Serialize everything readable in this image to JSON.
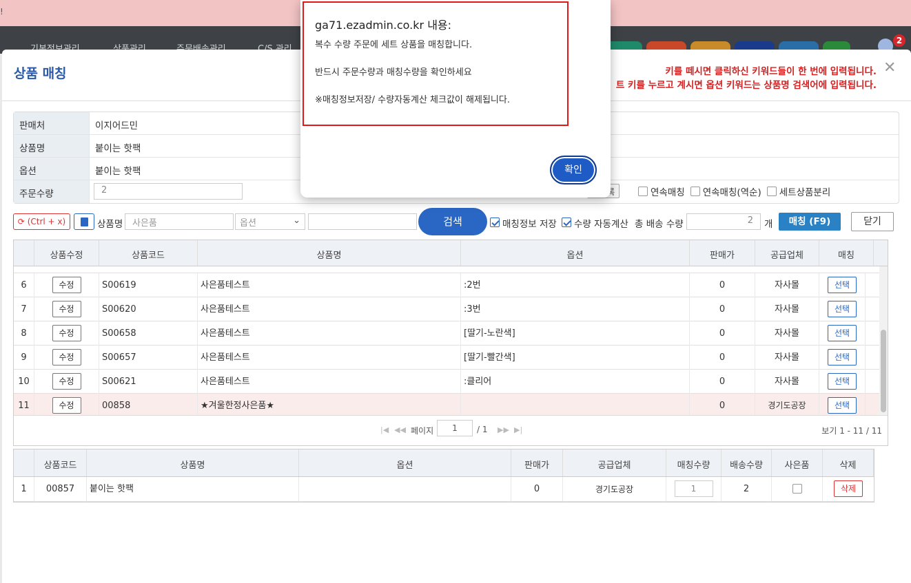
{
  "topbar": {
    "left_label": "!"
  },
  "nav": {
    "items": [
      "기본정보관리",
      "상품관리",
      "주문배송관리",
      "C/S 관리"
    ],
    "notification_count": "2"
  },
  "modal": {
    "title": "상품 매칭",
    "warnings": [
      "키를 떼시면 클릭하신 키워드들이 한 번에 입력됩니다.",
      "트 키를 누르고 계시면 옵션 키워드는 상품명 검색어에 입력됩니다."
    ],
    "info": {
      "rows": [
        {
          "label": "판매처",
          "value": "이지어드민"
        },
        {
          "label": "상품명",
          "value": "붙이는 핫팩"
        },
        {
          "label": "옵션",
          "value": "붙이는 핫팩"
        },
        {
          "label": "주문수량",
          "value": "2"
        }
      ],
      "register_btn": "품등록",
      "checkboxes": [
        {
          "label": "연속매칭"
        },
        {
          "label": "연속매칭(역순)"
        },
        {
          "label": "세트상품분리"
        }
      ]
    },
    "toolbar": {
      "refresh_label": "(Ctrl + x)",
      "product_name_label": "상품명",
      "product_name_placeholder": "사은품",
      "option_select": "옵션",
      "search_button": "검색",
      "save_match_label": "매칭정보 저장",
      "auto_qty_label": "수량 자동계산",
      "total_ship_qty_label": "총 배송 수량",
      "total_ship_qty_value": "2",
      "unit": "개",
      "match_button": "매칭 (F9)",
      "close_button": "닫기"
    },
    "grid": {
      "headers": [
        "상품수정",
        "상품코드",
        "상품명",
        "옵션",
        "판매가",
        "공급업체",
        "매칭"
      ],
      "rows": [
        {
          "no": "6",
          "edit": "수정",
          "code": "S00619",
          "name": "사은품테스트",
          "option": ":2번",
          "price": "0",
          "supplier": "자사몰",
          "select": "선택"
        },
        {
          "no": "7",
          "edit": "수정",
          "code": "S00620",
          "name": "사은품테스트",
          "option": ":3번",
          "price": "0",
          "supplier": "자사몰",
          "select": "선택"
        },
        {
          "no": "8",
          "edit": "수정",
          "code": "S00658",
          "name": "사은품테스트",
          "option": "[딸기-노란색]",
          "price": "0",
          "supplier": "자사몰",
          "select": "선택"
        },
        {
          "no": "9",
          "edit": "수정",
          "code": "S00657",
          "name": "사은품테스트",
          "option": "[딸기-빨간색]",
          "price": "0",
          "supplier": "자사몰",
          "select": "선택"
        },
        {
          "no": "10",
          "edit": "수정",
          "code": "S00621",
          "name": "사은품테스트",
          "option": ":클리어",
          "price": "0",
          "supplier": "자사몰",
          "select": "선택"
        },
        {
          "no": "11",
          "edit": "수정",
          "code": "00858",
          "name": "★겨울한정사은품★",
          "option": "",
          "price": "0",
          "supplier": "경기도공장",
          "select": "선택"
        }
      ],
      "pager": {
        "page_label": "페이지",
        "page_value": "1",
        "page_total": "/ 1",
        "view_text": "보기 1 - 11 / 11"
      }
    },
    "grid2": {
      "headers": [
        "상품코드",
        "상품명",
        "옵션",
        "판매가",
        "공급업체",
        "매칭수량",
        "배송수량",
        "사은품",
        "삭제"
      ],
      "rows": [
        {
          "no": "1",
          "code": "00857",
          "name": "붙이는 핫팩",
          "option": "",
          "price": "0",
          "supplier": "경기도공장",
          "match_qty": "1",
          "ship_qty": "2",
          "delete": "삭제"
        }
      ]
    }
  },
  "dialog": {
    "title": "ga71.ezadmin.co.kr 내용:",
    "lines": [
      "복수 수량 주문에 세트 상품을 매칭합니다.",
      "반드시 주문수량과 매칭수량을 확인하세요",
      "※매칭정보저장/ 수량자동계산 체크값이 해제됩니다."
    ],
    "ok_button": "확인"
  }
}
